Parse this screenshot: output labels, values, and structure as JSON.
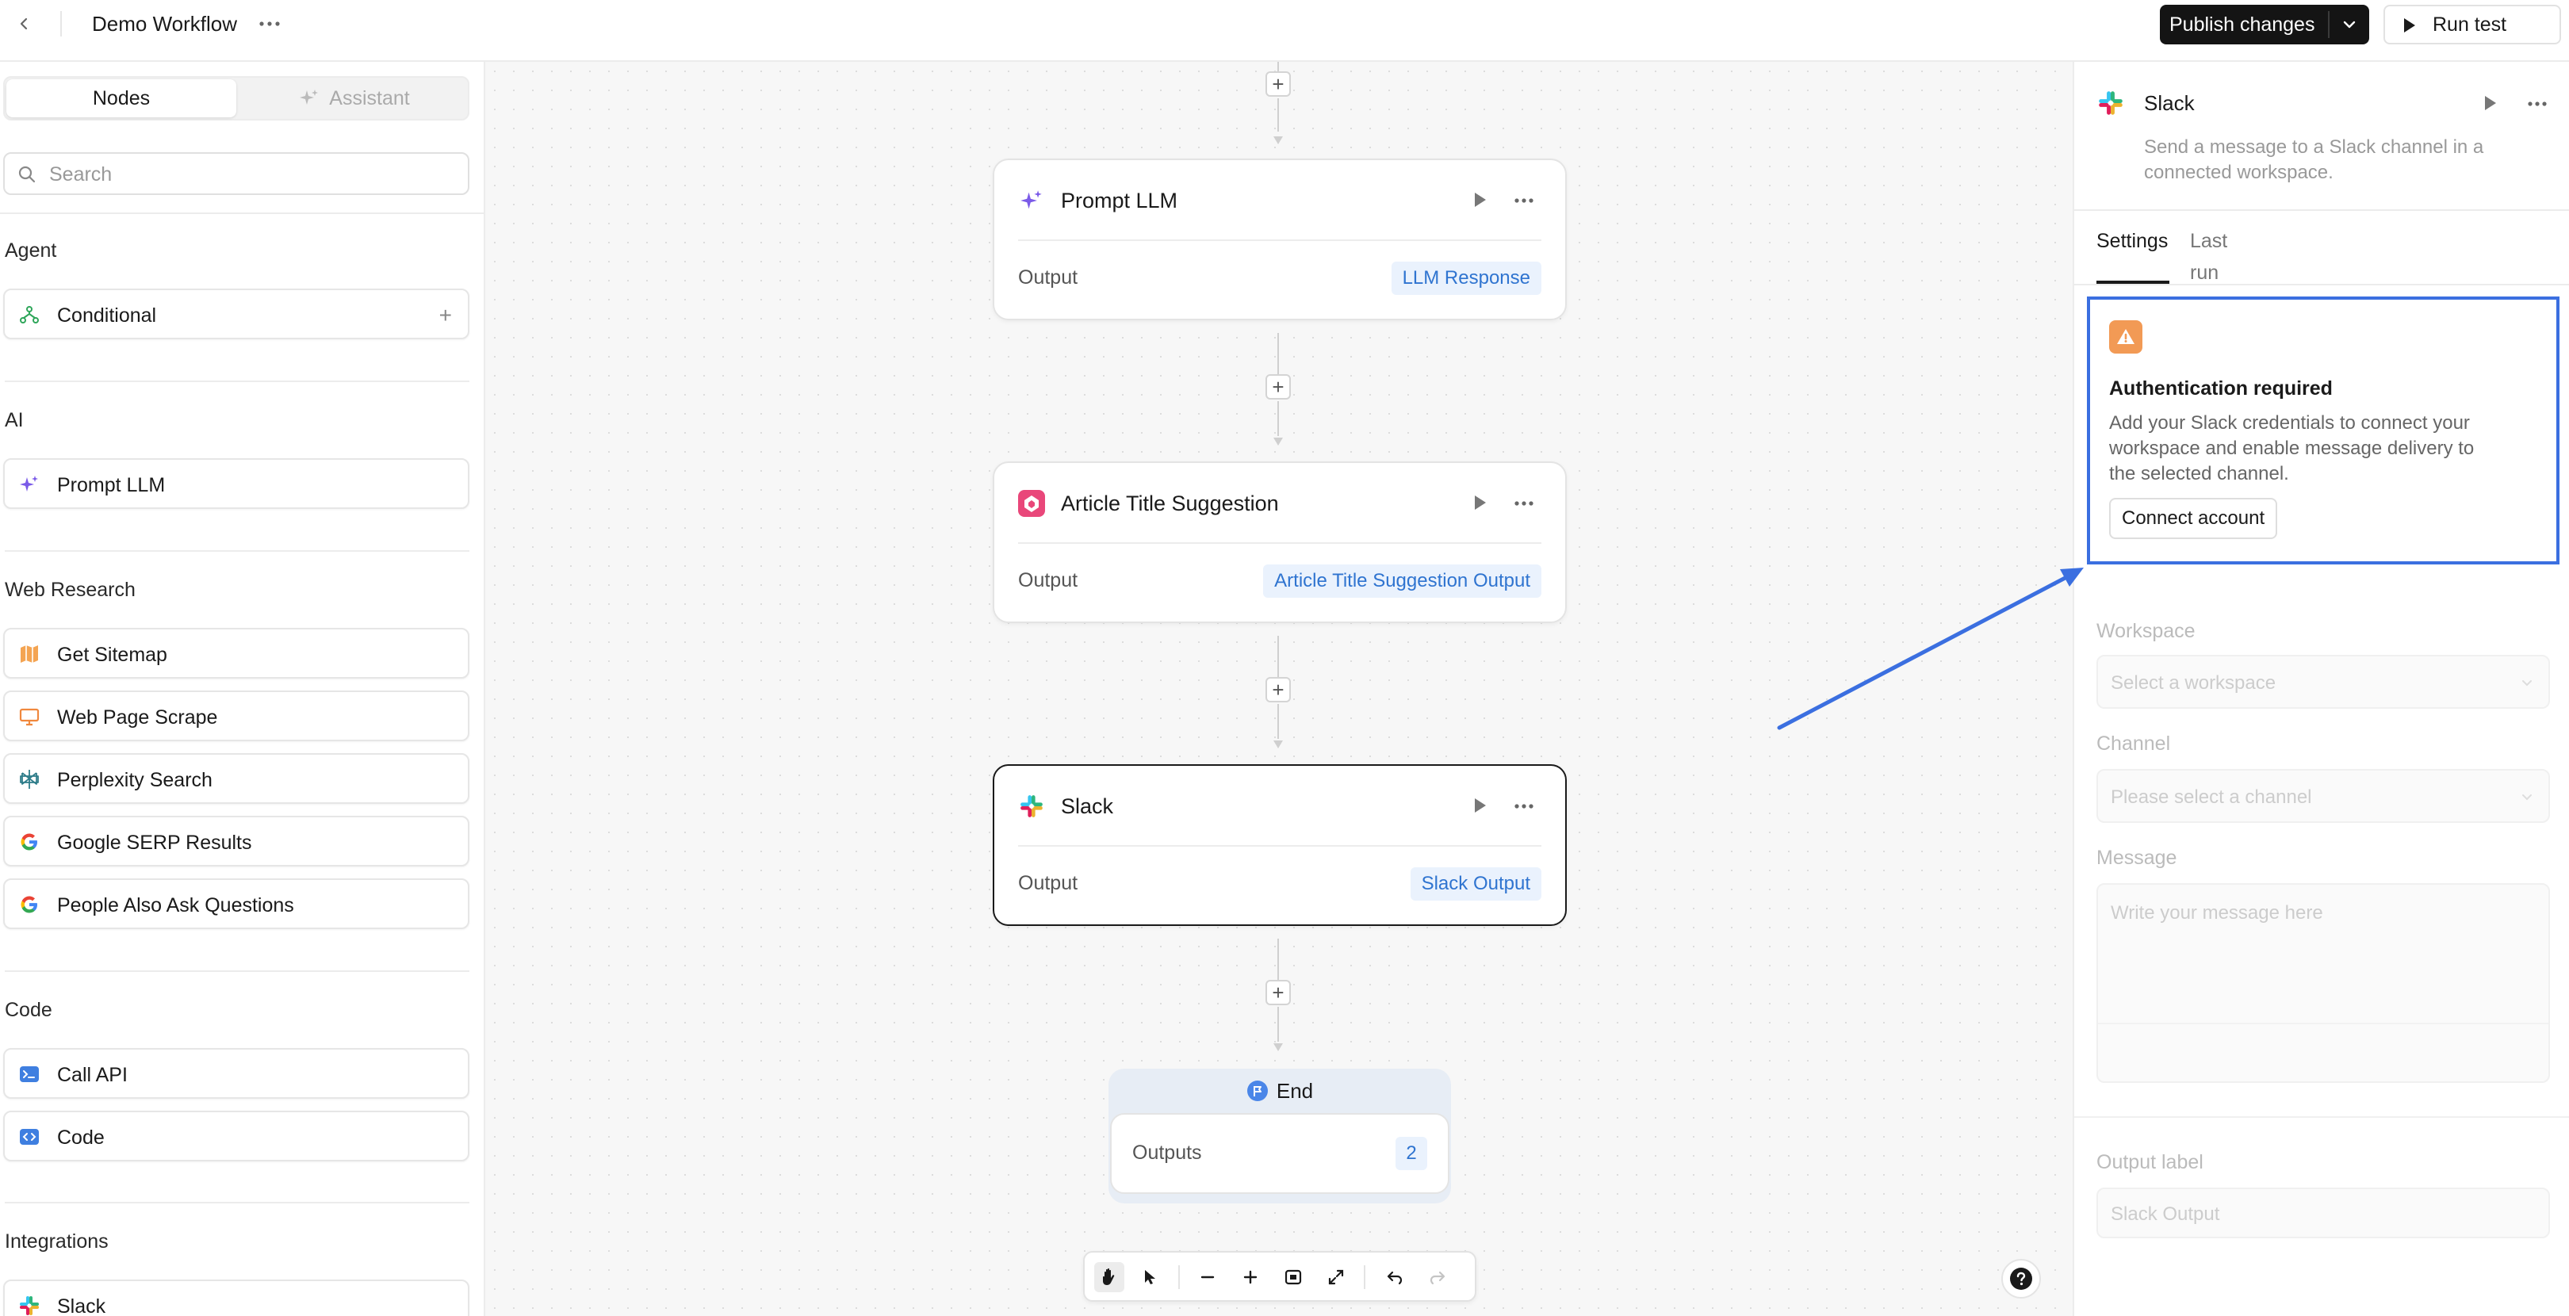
{
  "topbar": {
    "workflow_title": "Demo Workflow",
    "publish_label": "Publish changes",
    "run_test_label": "Run test"
  },
  "sidebar": {
    "tabs": [
      {
        "label": "Nodes",
        "active": true
      },
      {
        "label": "Assistant",
        "active": false
      }
    ],
    "search_placeholder": "Search",
    "sections": [
      {
        "title": "Agent",
        "items": [
          {
            "label": "Conditional",
            "icon": "branch-icon"
          }
        ]
      },
      {
        "title": "AI",
        "items": [
          {
            "label": "Prompt LLM",
            "icon": "sparkle-icon"
          }
        ]
      },
      {
        "title": "Web Research",
        "items": [
          {
            "label": "Get Sitemap",
            "icon": "map-icon"
          },
          {
            "label": "Web Page Scrape",
            "icon": "monitor-icon"
          },
          {
            "label": "Perplexity Search",
            "icon": "perplexity-icon"
          },
          {
            "label": "Google SERP Results",
            "icon": "google-icon"
          },
          {
            "label": "People Also Ask Questions",
            "icon": "google-icon"
          }
        ]
      },
      {
        "title": "Code",
        "items": [
          {
            "label": "Call API",
            "icon": "terminal-icon"
          },
          {
            "label": "Code",
            "icon": "code-icon"
          }
        ]
      },
      {
        "title": "Integrations",
        "items": [
          {
            "label": "Slack",
            "icon": "slack-icon"
          }
        ]
      }
    ]
  },
  "canvas": {
    "nodes": [
      {
        "title": "Prompt LLM",
        "output_label": "Output",
        "output_value": "LLM Response",
        "icon": "sparkle-icon"
      },
      {
        "title": "Article Title Suggestion",
        "output_label": "Output",
        "output_value": "Article Title Suggestion Output",
        "icon": "article-icon"
      },
      {
        "title": "Slack",
        "output_label": "Output",
        "output_value": "Slack Output",
        "icon": "slack-icon",
        "selected": true
      }
    ],
    "end_node": {
      "title": "End",
      "outputs_label": "Outputs",
      "outputs_count": "2"
    }
  },
  "right_panel": {
    "title": "Slack",
    "description": "Send a message to a Slack channel in a connected workspace.",
    "tabs": [
      {
        "label": "Settings",
        "active": true
      },
      {
        "label": "Last run",
        "active": false
      }
    ],
    "auth": {
      "title": "Authentication required",
      "description": "Add your Slack credentials to connect your workspace and enable message delivery to the selected channel.",
      "button_label": "Connect account"
    },
    "fields": {
      "workspace_label": "Workspace",
      "workspace_placeholder": "Select a workspace",
      "channel_label": "Channel",
      "channel_placeholder": "Please select a channel",
      "message_label": "Message",
      "message_placeholder": "Write your message here",
      "output_label": "Output label",
      "output_placeholder": "Slack Output"
    }
  },
  "colors": {
    "accent_blue": "#3b6fe0",
    "badge_blue": "#2f74d0",
    "warning_orange": "#f29a55"
  }
}
